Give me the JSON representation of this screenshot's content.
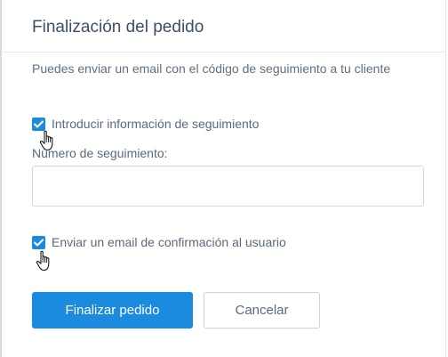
{
  "dialog": {
    "title": "Finalización del pedido",
    "description": "Puedes enviar un email con el código de seguimiento a tu cliente",
    "tracking_checkbox": {
      "label": "Introducir información de seguimiento",
      "checked": true
    },
    "tracking_field": {
      "label": "Número de seguimiento:",
      "value": "",
      "placeholder": ""
    },
    "email_checkbox": {
      "label": "Enviar un email de confirmación al usuario",
      "checked": true
    },
    "buttons": {
      "finalize_label": "Finalizar pedido",
      "cancel_label": "Cancelar"
    }
  },
  "colors": {
    "primary": "#1b8be0",
    "title": "#3d4f66",
    "text": "#5a6a7d",
    "border": "#d5d9de"
  },
  "icons": {
    "check": "check-icon",
    "pointer": "hand-pointer-icon"
  }
}
